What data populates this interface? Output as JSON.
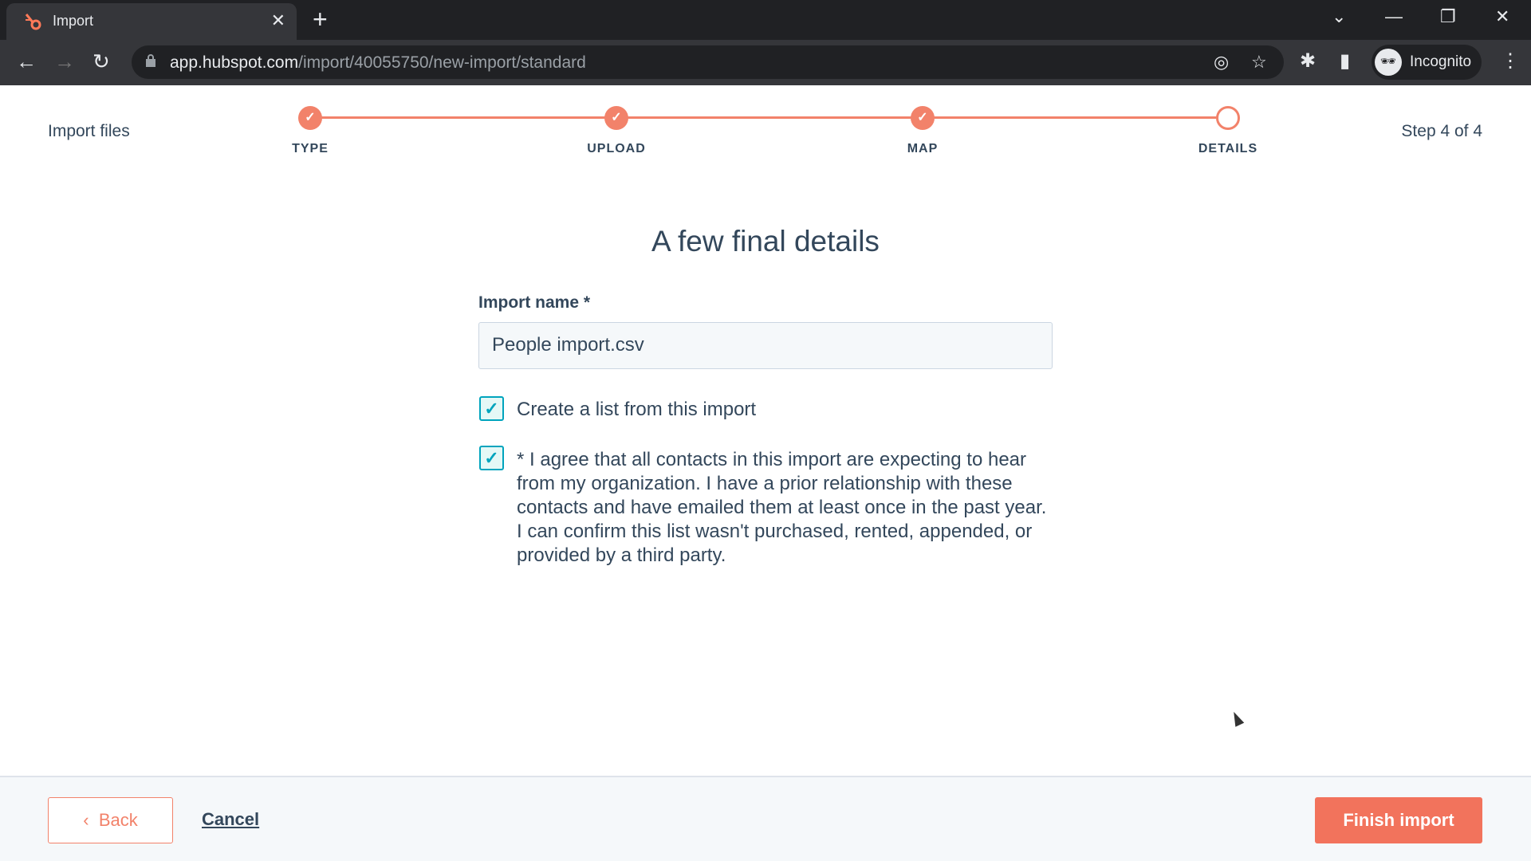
{
  "browser": {
    "tab_title": "Import",
    "url_host": "app.hubspot.com",
    "url_path": "/import/40055750/new-import/standard",
    "profile_label": "Incognito"
  },
  "header": {
    "title": "Import files",
    "step_counter": "Step 4 of 4",
    "steps": [
      {
        "label": "TYPE",
        "done": true
      },
      {
        "label": "UPLOAD",
        "done": true
      },
      {
        "label": "MAP",
        "done": true
      },
      {
        "label": "DETAILS",
        "done": false
      }
    ]
  },
  "main": {
    "heading": "A few final details",
    "import_name_label": "Import name *",
    "import_name_value": "People import.csv",
    "create_list": {
      "label": "Create a list from this import",
      "checked": true
    },
    "consent": {
      "label": "* I agree that all contacts in this import are expecting to hear from my organization. I have a prior relationship with these contacts and have emailed them at least once in the past year. I can confirm this list wasn't purchased, rented, appended, or provided by a third party.",
      "checked": true
    }
  },
  "footer": {
    "back_label": "Back",
    "cancel_label": "Cancel",
    "finish_label": "Finish import"
  },
  "colors": {
    "accent": "#f2826a",
    "checkbox": "#00a4bd",
    "finish_button": "#f2735c"
  }
}
